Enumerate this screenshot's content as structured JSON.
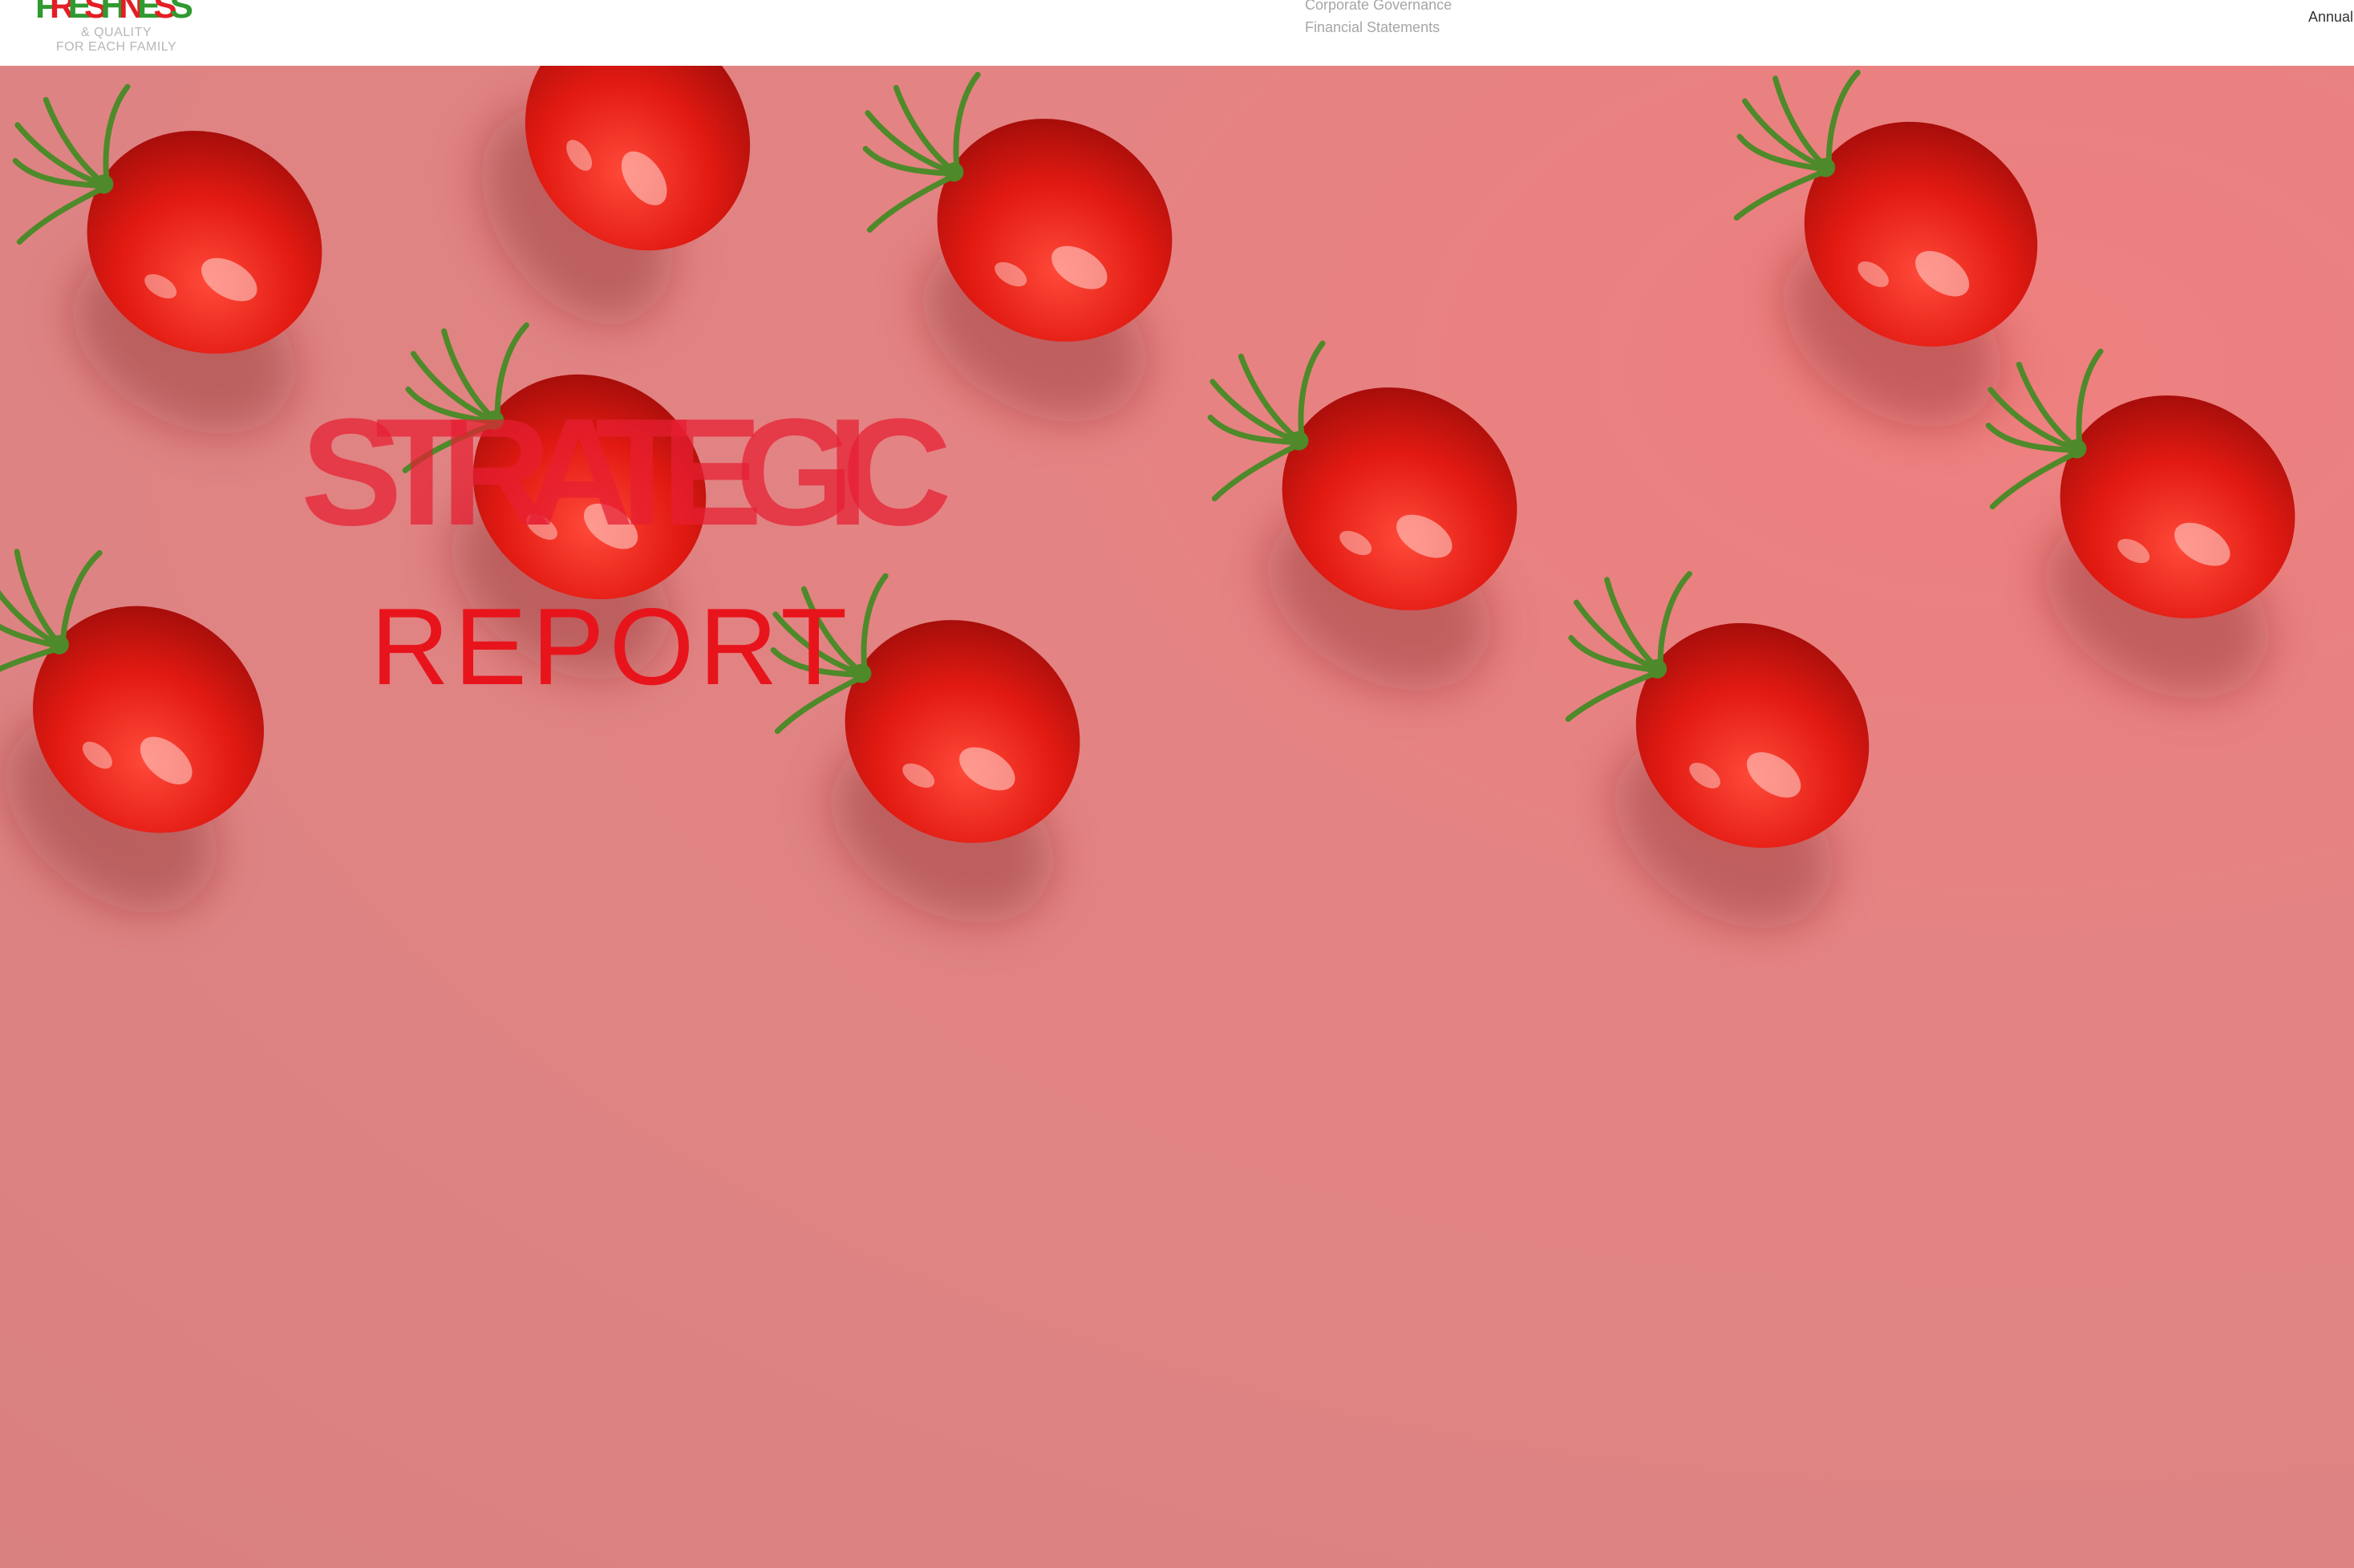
{
  "logo": {
    "word": "FRESHNESS",
    "tagline_line1": "& QUALITY",
    "tagline_line2": "FOR EACH FAMILY"
  },
  "nav": {
    "items": [
      "Corporate Governance",
      "Financial Statements"
    ]
  },
  "header_right_label": "Annual",
  "section": {
    "title": "STRATEGIC",
    "subtitle": "REPORT"
  },
  "colors": {
    "background_pink": "#de8383",
    "title_red": "#e8141c",
    "tomato_red": "#e21a12",
    "stem_green": "#4e8a2a",
    "logo_green": "#2f9a2f",
    "logo_red": "#e31e24"
  }
}
